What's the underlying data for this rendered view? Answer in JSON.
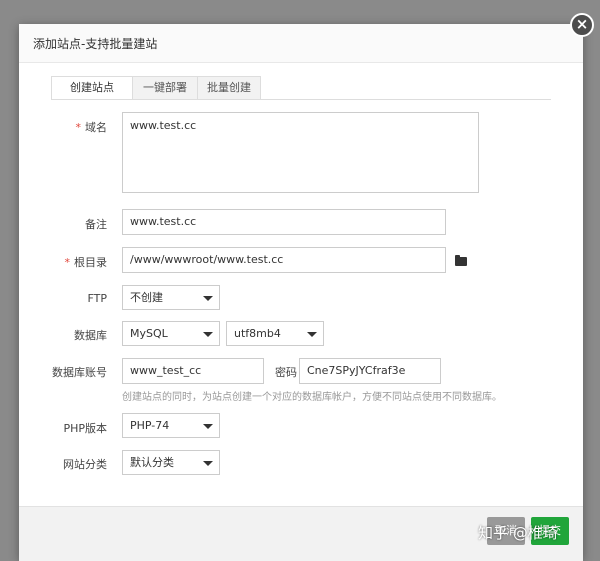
{
  "dialog": {
    "title": "添加站点-支持批量建站"
  },
  "tabs": [
    {
      "label": "创建站点",
      "active": true
    },
    {
      "label": "一键部署",
      "active": false
    },
    {
      "label": "批量创建",
      "active": false
    }
  ],
  "form": {
    "domain": {
      "label": "域名",
      "required": true,
      "value": "www.test.cc"
    },
    "remark": {
      "label": "备注",
      "value": "www.test.cc"
    },
    "root": {
      "label": "根目录",
      "required": true,
      "value": "/www/wwwroot/www.test.cc",
      "icon": "folder-open-icon"
    },
    "ftp": {
      "label": "FTP",
      "value": "不创建"
    },
    "database": {
      "label": "数据库",
      "type": "MySQL",
      "charset": "utf8mb4"
    },
    "db_account": {
      "label": "数据库账号",
      "user": "www_test_cc",
      "password_label": "密码",
      "password": "Cne7SPyJYCfraf3e",
      "hint": "创建站点的同时，为站点创建一个对应的数据库帐户，方便不同站点使用不同数据库。"
    },
    "php": {
      "label": "PHP版本",
      "value": "PHP-74"
    },
    "category": {
      "label": "网站分类",
      "value": "默认分类"
    }
  },
  "footer": {
    "cancel_label": "取消",
    "submit_label": "提交"
  },
  "watermark": "知乎 @椎琦",
  "colors": {
    "submit": "#20a53a",
    "required": "#e0463b",
    "close": "#4d4d4d"
  }
}
